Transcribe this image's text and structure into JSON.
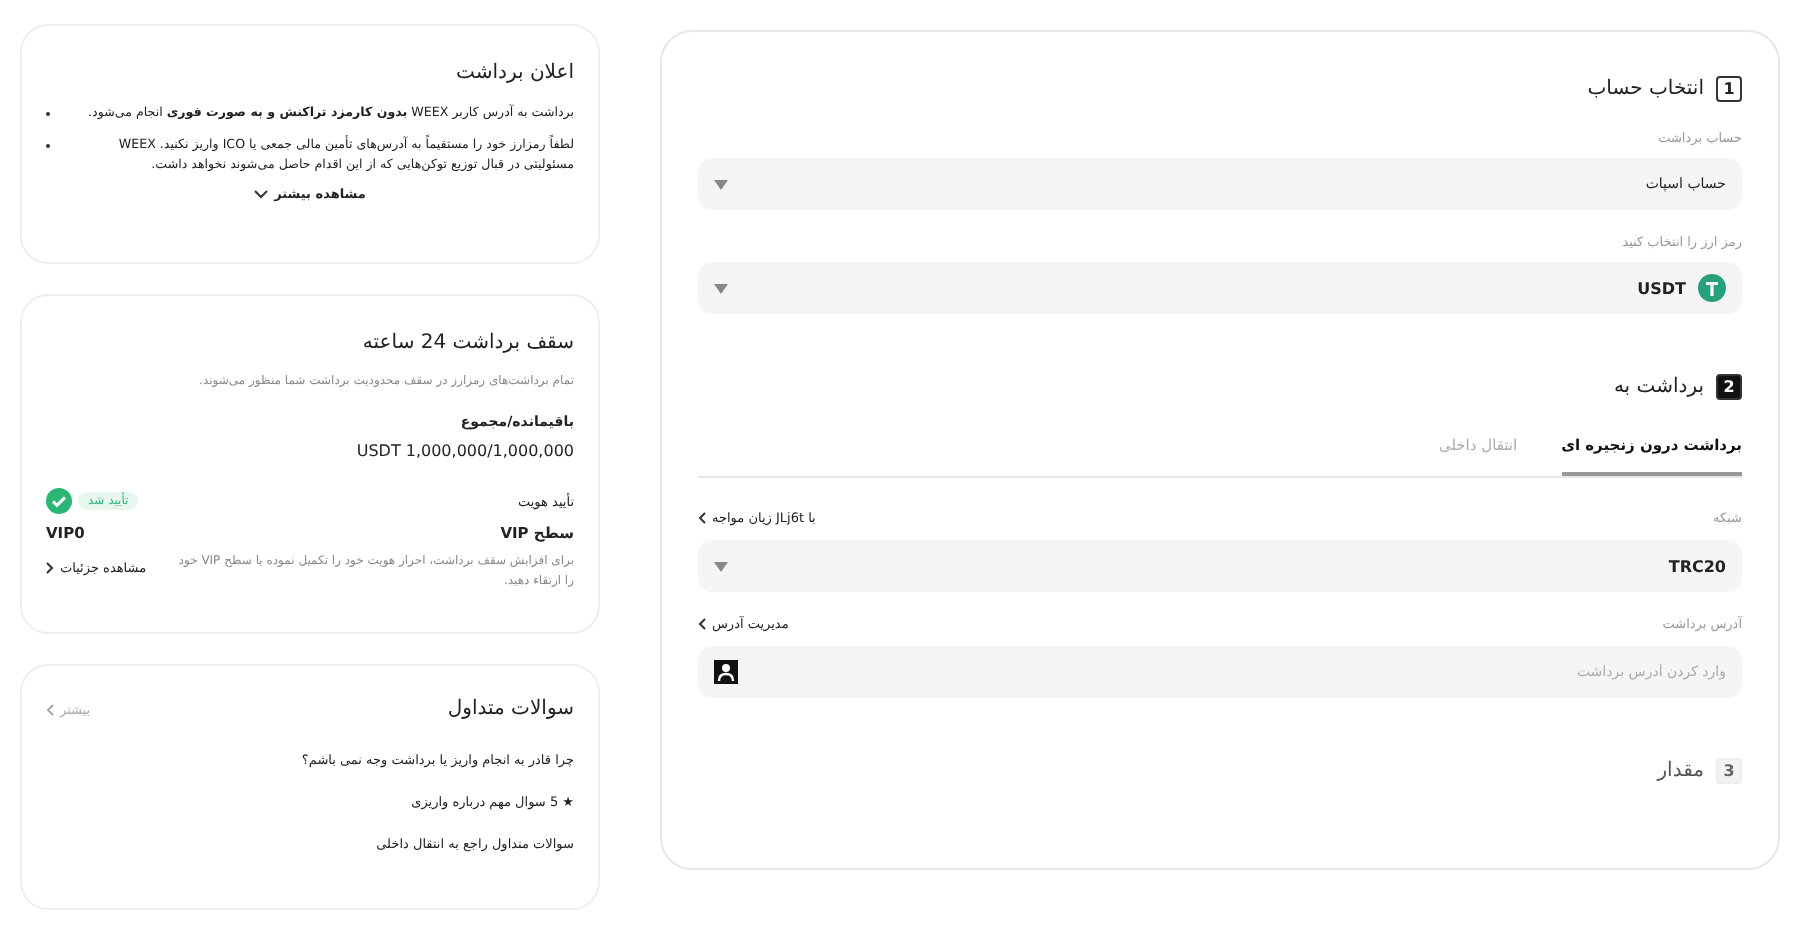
{
  "notice": {
    "title": "اعلان برداشت",
    "bullets": [
      "برداشت به آدرس کاربر WEEX **بدون کارمزد تراکنش و به صورت فوری** انجام می‌شود.",
      "لطفاً رمزارز خود را مستقیماً به آدرس‌های تأمین مالی جمعی یا ICO واریز نکنید. WEEX مسئولیتی در قبال توزیع توکن‌هایی که از این اقدام حاصل می‌شوند نخواهد داشت."
    ],
    "more": "مشاهده بیشتر"
  },
  "limit": {
    "title": "سقف برداشت 24 ساعته",
    "subtitle": "تمام برداشت‌های رمزارز در سقف محدودیت برداشت شما منظور می‌شوند.",
    "remaining_label": "باقیمانده/مجموع",
    "remaining_value": "USDT 1,000,000/1,000,000",
    "identity_label": "تأیید هویت",
    "identity_status": "تأیید شد",
    "verified": true,
    "vip_label": "سطح VIP",
    "vip_value": "VIP0",
    "hint": "برای افزایش سقف برداشت، احراز هویت خود را تکمیل نموده یا سطح VIP خود را ارتقاء دهید.",
    "details": "مشاهده جزئیات"
  },
  "faq": {
    "title": "سوالات متداول",
    "more": "بیشتر",
    "items": [
      "چرا قادر به انجام واریز یا برداشت وجه نمی باشم؟",
      "★ 5 سوال مهم درباره واریزی",
      "سوالات متداول راجع به انتقال داخلی"
    ]
  },
  "steps": [
    {
      "number": "1",
      "title": "انتخاب حساب",
      "active": false
    },
    {
      "number": "2",
      "title": "برداشت به",
      "active": true
    },
    {
      "number": "3",
      "title": "مقدار",
      "active": false
    }
  ],
  "account": {
    "label": "حساب برداشت",
    "value": "حساب اسپات"
  },
  "coin": {
    "label": "رمز ارز را انتخاب کنید",
    "value": "USDT"
  },
  "tabs": [
    {
      "label": "برداشت درون زنجیره ای",
      "selected": true
    },
    {
      "label": "انتقال داخلی",
      "selected": false
    }
  ],
  "network": {
    "label": "شبکه",
    "link": "با JLj6t زیان مواجه",
    "value": "TRC20"
  },
  "address": {
    "label": "آدرس برداشت",
    "link": "مدیریت آدرس",
    "placeholder": "وارد کردن آدرس برداشت"
  }
}
